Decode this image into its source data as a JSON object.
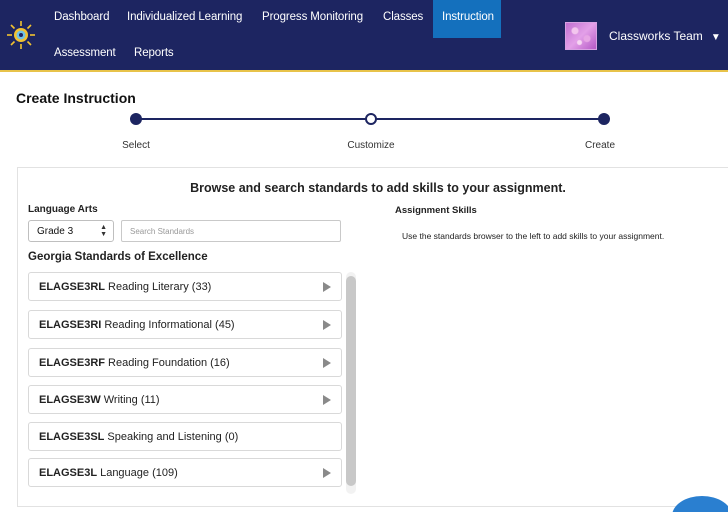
{
  "nav": {
    "items": [
      "Dashboard",
      "Individualized Learning",
      "Progress Monitoring",
      "Classes",
      "Instruction"
    ],
    "items_row2": [
      "Assessment",
      "Reports"
    ],
    "active": "Instruction",
    "user_name": "Classworks Team",
    "colors": {
      "bar": "#1d2561",
      "active": "#1470bd",
      "accent": "#e8c34a"
    }
  },
  "page": {
    "title": "Create Instruction"
  },
  "stepper": {
    "steps": [
      "Select",
      "Customize",
      "Create"
    ]
  },
  "browser": {
    "heading": "Browse and search standards to add skills to your assignment.",
    "subject": "Language Arts",
    "grade": "Grade 3",
    "search_placeholder": "Search Standards",
    "framework": "Georgia Standards of Excellence",
    "standards": [
      {
        "code": "ELAGSE3RL",
        "name": "Reading Literary (33)",
        "arrow": true
      },
      {
        "code": "ELAGSE3RI",
        "name": "Reading Informational (45)",
        "arrow": true
      },
      {
        "code": "ELAGSE3RF",
        "name": "Reading Foundation (16)",
        "arrow": true
      },
      {
        "code": "ELAGSE3W",
        "name": "Writing (11)",
        "arrow": true
      },
      {
        "code": "ELAGSE3SL",
        "name": "Speaking and Listening (0)",
        "arrow": false
      },
      {
        "code": "ELAGSE3L",
        "name": "Language (109)",
        "arrow": true
      }
    ]
  },
  "skills": {
    "title": "Assignment Skills",
    "hint": "Use the standards browser to the left to add skills to your assignment."
  }
}
